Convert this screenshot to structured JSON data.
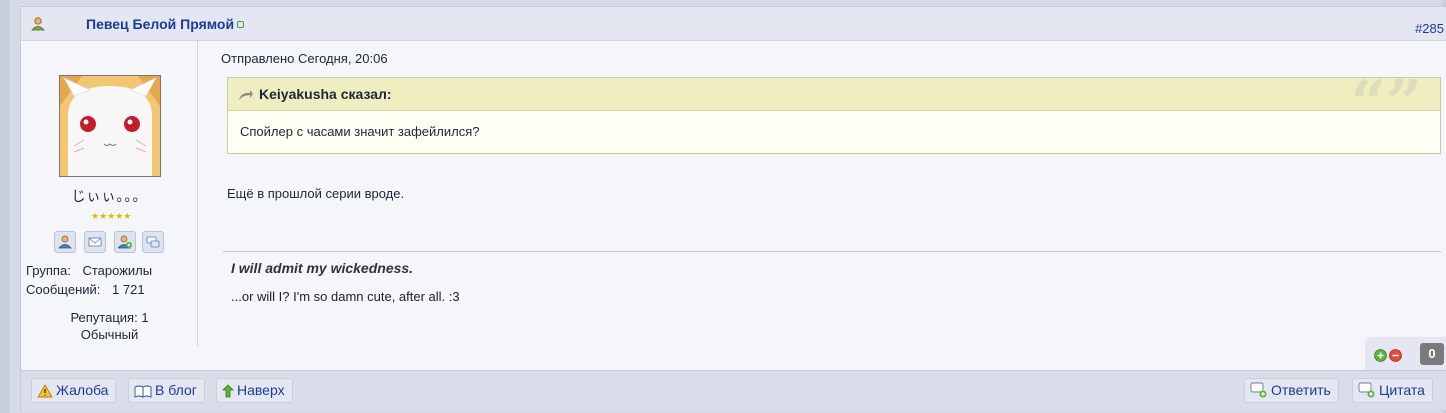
{
  "header": {
    "author_name": "Певец Белой Прямой",
    "post_number": "#285"
  },
  "author": {
    "nickname": "じぃぃ。。。",
    "stars": "★★★★★",
    "group_label": "Группа:",
    "group_value": "Старожилы",
    "posts_label": "Сообщений:",
    "posts_value": "1 721",
    "reputation": "Репутация: 1",
    "reputation_level": "Обычный"
  },
  "post": {
    "posted": "Отправлено Сегодня, 20:06",
    "quote_title": "Keiyakusha сказал:",
    "quote_text": "Спойлер с часами значит зафейлился?",
    "text": "Ещё в прошлой серии вроде.",
    "signature_title": "I will admit my wickedness.",
    "signature_text": "...or will I? I'm so damn cute, after all. :3"
  },
  "rating": {
    "count": "0"
  },
  "footer": {
    "report": "Жалоба",
    "blog": "В блог",
    "top": "Наверх",
    "reply": "Ответить",
    "quote": "Цитата"
  },
  "colors": {
    "link": "#1d3a9a",
    "quote_header": "#eeeec0",
    "header_bg": "#e4e7f2"
  }
}
